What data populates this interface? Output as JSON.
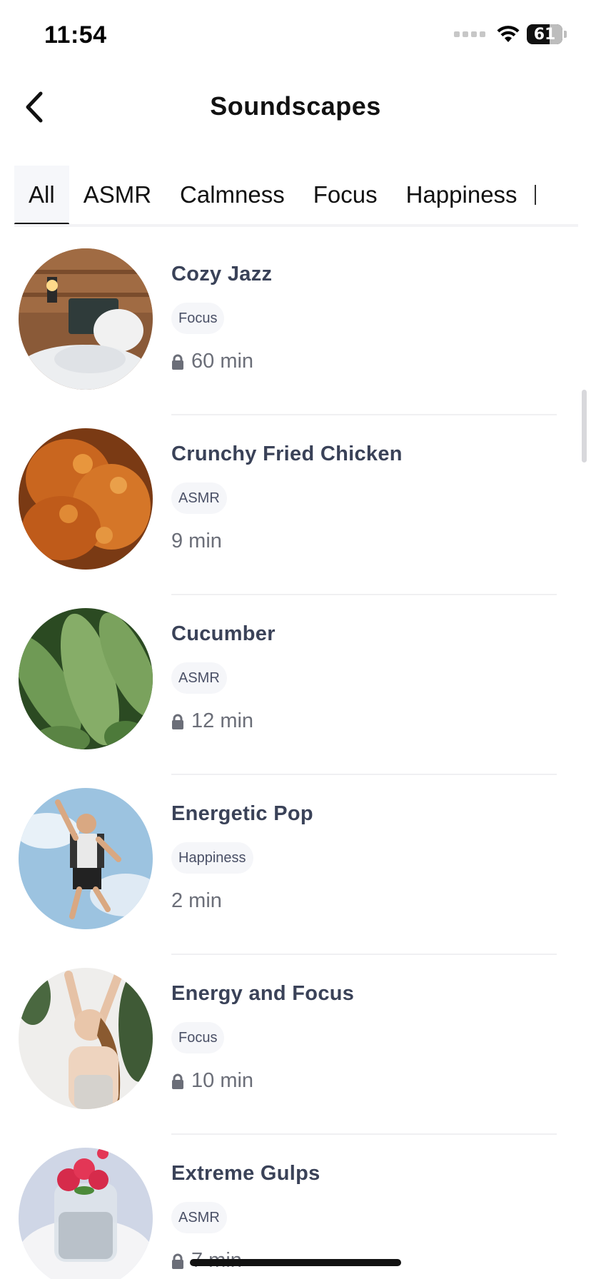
{
  "status_bar": {
    "time": "11:54",
    "battery": "61"
  },
  "header": {
    "title": "Soundscapes"
  },
  "tabs": [
    {
      "label": "All",
      "active": true
    },
    {
      "label": "ASMR",
      "active": false
    },
    {
      "label": "Calmness",
      "active": false
    },
    {
      "label": "Focus",
      "active": false
    },
    {
      "label": "Happiness",
      "active": false
    }
  ],
  "items": [
    {
      "title": "Cozy Jazz",
      "tag": "Focus",
      "duration": "60 min",
      "locked": true,
      "image_icon": "reading-in-bed-photo"
    },
    {
      "title": "Crunchy Fried Chicken",
      "tag": "ASMR",
      "duration": "9 min",
      "locked": false,
      "image_icon": "fried-chicken-photo"
    },
    {
      "title": "Cucumber",
      "tag": "ASMR",
      "duration": "12 min",
      "locked": true,
      "image_icon": "cucumbers-photo"
    },
    {
      "title": "Energetic Pop",
      "tag": "Happiness",
      "duration": "2 min",
      "locked": false,
      "image_icon": "jumping-man-photo"
    },
    {
      "title": "Energy and Focus",
      "tag": "Focus",
      "duration": "10 min",
      "locked": true,
      "image_icon": "stretching-woman-photo"
    },
    {
      "title": "Extreme Gulps",
      "tag": "ASMR",
      "duration": "7 min",
      "locked": true,
      "image_icon": "chia-dessert-photo"
    }
  ]
}
